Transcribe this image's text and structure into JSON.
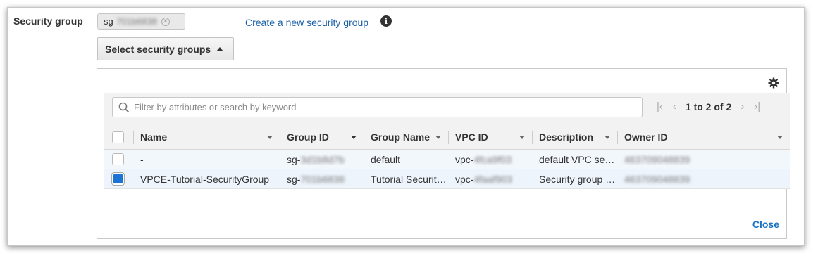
{
  "field": {
    "label": "Security group"
  },
  "token": {
    "prefix": "sg-",
    "masked": "701b6838"
  },
  "create_link": "Create a new security group",
  "select_button": "Select security groups",
  "search": {
    "placeholder": "Filter by attributes or search by keyword",
    "value": ""
  },
  "pagination": {
    "text": "1 to 2 of 2"
  },
  "columns": [
    "Name",
    "Group ID",
    "Group Name",
    "VPC ID",
    "Description",
    "Owner ID"
  ],
  "rows": [
    {
      "selected": false,
      "name": "-",
      "group_id_prefix": "sg-",
      "group_id_masked": "3d1b8d7b",
      "group_name": "default",
      "vpc_prefix": "vpc-",
      "vpc_masked": "4fca9f03",
      "description": "default VPC security group",
      "owner_masked": "463709048839"
    },
    {
      "selected": true,
      "name": "VPCE-Tutorial-SecurityGroup",
      "group_id_prefix": "sg-",
      "group_id_masked": "701b6838",
      "group_name": "Tutorial Security Group",
      "vpc_prefix": "vpc-",
      "vpc_masked": "4faaf903",
      "description": "Security group for tutorial",
      "owner_masked": "463709048839"
    }
  ],
  "close_label": "Close",
  "colors": {
    "link": "#1a5fa6",
    "checkbox_selected": "#1b73d3",
    "header_bg": "#f2f2f2"
  }
}
